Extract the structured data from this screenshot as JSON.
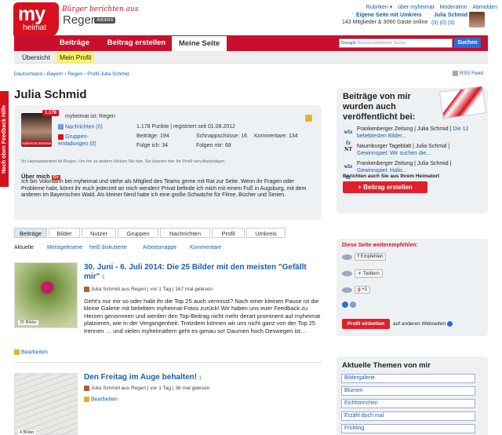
{
  "header": {
    "logo_top": "my",
    "logo_bottom": "heimat",
    "tagline": "Bürger berichten aus",
    "region": "Regen",
    "region_badge": "ÄNDERN",
    "top_links": [
      "Rubriken ▾",
      "über myheimat",
      "Moderation",
      "Abmelden"
    ],
    "my_home": "Eigene Seite mit Umkreis",
    "members": "143 Mitglieder & 3066 Gäste online",
    "username": "Julia Schmid",
    "user_counts": "(0)  (0)  (0)"
  },
  "nav": {
    "tabs": [
      "Beiträge",
      "Beitrag erstellen",
      "Meine Seite"
    ],
    "search_placeholder_brand": "Google",
    "search_placeholder": "Benutzerdefinierte Suche",
    "search_button": "Suchen",
    "sub_tabs": [
      "Übersicht",
      "Mein Profil"
    ]
  },
  "breadcrumb": "Deutschland › Bayern › Regen › Profil Julia Schmid",
  "rss": "RSS Feed",
  "side_tab": "Nach oben   Feedback   Hilfe",
  "profile": {
    "name": "Julia Schmid",
    "badge": "1.178",
    "avatar_caption": "myheimat Zentrale",
    "home_line": "myheimat ist: Regen",
    "messages": "Nachrichten (0)",
    "groups": "Gruppen- einladungen (0)",
    "points": "1.178 Punkte | registriert seit 01.08.2012",
    "stats": [
      {
        "label": "Beiträge: 194"
      },
      {
        "label": "Schnappschüsse: 16"
      },
      {
        "label": "Kommentare: 134"
      },
      {
        "label": "Folge ich: 34"
      },
      {
        "label": "Folgen mir: 68"
      }
    ],
    "home_note": "Ihr Heimatstandort ist Regen. Um ihn zu ändern klicken Sie hier. Sie können hier Ihr Profil vervollständigen.",
    "about_title": "Über mich",
    "gplus": "G+",
    "about_text": "Ich bin Volontärin bei myheimat und stehe als Mitglied des Teams gerne mit Rat zur Seite. Wenn ihr Fragen oder Probleme habt, könnt ihr euch jederzeit an mich wenden! Privat befinde ich mich mit einem Fuß in Augsburg, mit dem anderen im Bayerischen Wald. Als kleiner Nerd habe ich eine große Schwäche für Filme, Bücher und Serien."
  },
  "tabs": [
    "Beiträge",
    "Bilder",
    "Nutzer",
    "Gruppen",
    "Nachrichten",
    "Profil",
    "Umkreis"
  ],
  "subtabs": [
    "Aktuelle",
    "Meistgelesene",
    "heiß diskutierte",
    "Arbeitsmappe",
    "Kommentare"
  ],
  "posts": [
    {
      "title": "30. Juni - 6. Juli 2014: Die 25 Bilder mit den meisten \"Gefällt mir\"",
      "comments": "5",
      "meta": "Julia Schmid aus Regen | vor 1 Tag | 167 mal gelesen",
      "body": "Geht's nur mir so oder habt ihr die Top 25 auch vermisst? Nach einer kleinen Pause ist die kleine Galerie mit beliebten myheimat-Fotos zurück! Wir haben uns euer Feedback zu Herzen genommen und werden den Top-Beitrag nicht mehr derart prominent auf myheimat platzieren, wie in der Vergangenheit. Trotzdem können wir uns nicht ganz von der Top 25 trennen … und vielen myheimatlern geht es genau so! Daumen hoch Deswegen ist…",
      "thumb_label": "25 Bilder",
      "edit": "Bearbeiten"
    },
    {
      "title": "Den Freitag im Auge behalten!",
      "comments": "1",
      "meta": "Julia Schmid aus Regen | vor 1 Tag | 36 mal gelesen",
      "thumb_label": "4 Bilder",
      "edit": "Bearbeiten"
    }
  ],
  "right": {
    "box1_title": "Beiträge von mir wurden auch veröffentlicht bei:",
    "sources": [
      {
        "logo": "wlz fz",
        "name": "Frankenberger Zeitung | Julia Schmid |",
        "link": "Die 12 beliebtesten Bilder..."
      },
      {
        "logo": "NT",
        "name": "Naumburger Tageblatt | Julia Schmid |",
        "link": "Gewinnspiel: Wir suchen die..."
      },
      {
        "logo": "wlz fz",
        "name": "Frankenberger Zeitung | Julia Schmid |",
        "link": "Gewinnspiel: Hallo..."
      }
    ],
    "box1_note": "Berichten auch Sie aus Ihrem Heimatort",
    "box1_button": "+ Beitrag erstellen",
    "box2_title": "Diese Seite weiterempfehlen:",
    "share_buttons": [
      "Empfehlen",
      "Twittern",
      "+1"
    ],
    "box2_button": "Profil einbetten",
    "box2_note": "auf anderen Webseiten",
    "box3_title": "Aktuelle Themen von mir",
    "topics": [
      "Bildergalerie",
      "Blumen",
      "Eichhörnchen",
      "Erzähl doch mal",
      "Frühling"
    ]
  }
}
